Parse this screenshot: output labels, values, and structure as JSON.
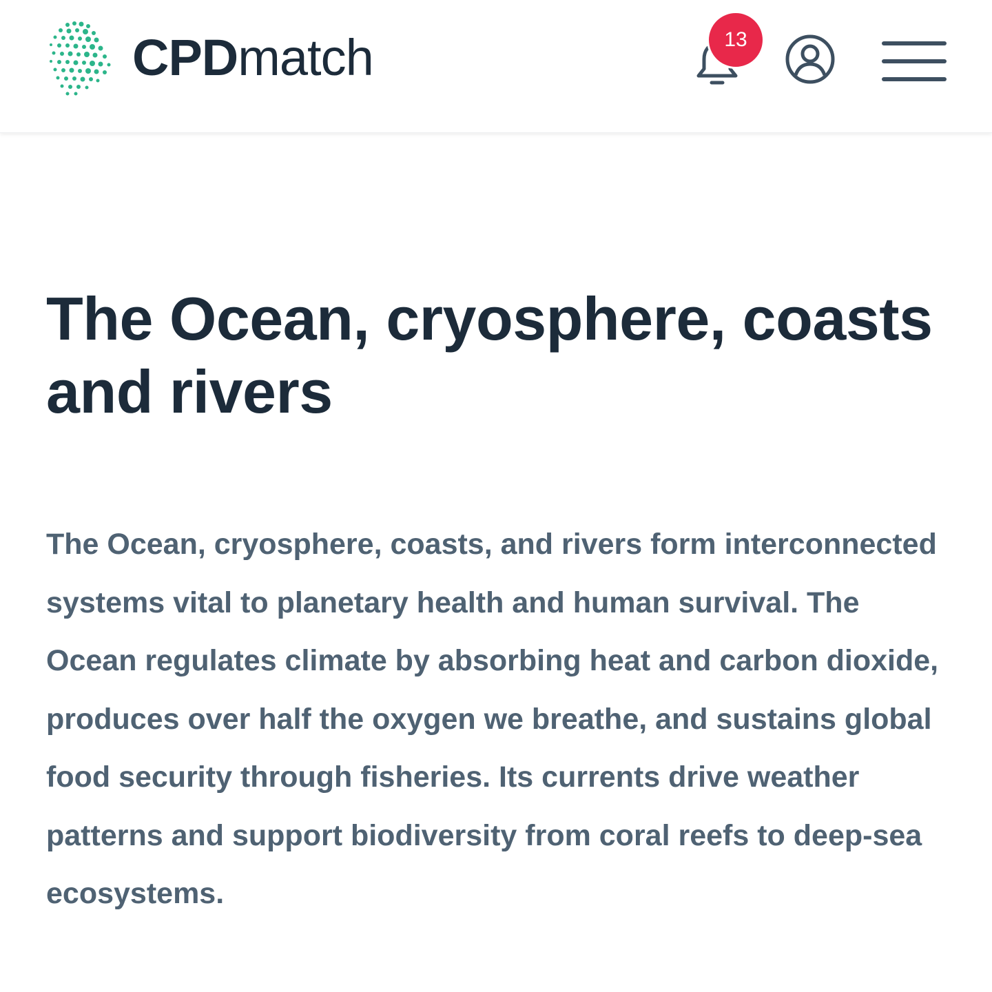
{
  "header": {
    "brand_bold": "CPD",
    "brand_light": "match",
    "notification_count": "13"
  },
  "article": {
    "title": "The Ocean, cryosphere, coasts and rivers",
    "body": "The Ocean, cryosphere, coasts, and rivers form interconnected systems vital to planetary health and human survival. The Ocean regulates climate by absorbing heat and carbon dioxide, produces over half the oxygen we breathe, and sustains global food security through fisheries. Its currents drive weather patterns and support biodiversity from coral reefs to deep-sea ecosystems."
  },
  "icons": {
    "logo": "dotted-head-logo",
    "notifications": "bell-icon",
    "account": "user-circle-icon",
    "menu": "hamburger-menu-icon"
  },
  "colors": {
    "brand_green": "#2cb58a",
    "heading": "#1c2b3a",
    "body": "#4f6273",
    "badge": "#e8284a"
  }
}
